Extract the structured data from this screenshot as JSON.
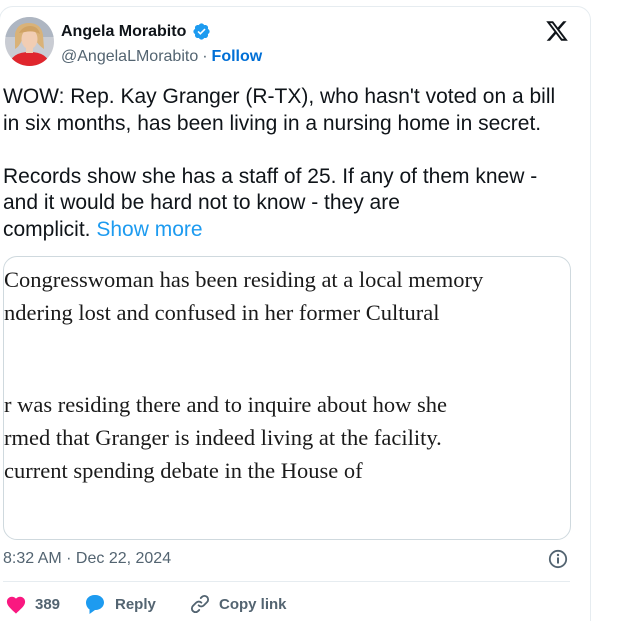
{
  "author": {
    "display_name": "Angela Morabito",
    "handle": "@AngelaLMorabito",
    "separator": "·",
    "follow_label": "Follow",
    "verified_color": "#1d9bf0",
    "avatar_icon": "profile-photo"
  },
  "brand_icon": "x-logo-icon",
  "tweet": {
    "text_paragraph_1": "WOW: Rep. Kay Granger (R-TX), who hasn't voted on a bill\nin six months, has been living in a nursing home in secret.",
    "text_paragraph_2": "Records show she has a staff of 25. If any of them knew -\nand it would be hard not to know - they are\ncomplicit. ",
    "show_more_label": "Show more"
  },
  "media": {
    "lines": [
      "Congresswoman has been residing at a local memory",
      "ndering lost and confused in her former Cultural",
      "r was residing there and to inquire about how she",
      "rmed that Granger is indeed living at the facility.",
      "current spending debate in the House of"
    ]
  },
  "meta": {
    "timestamp": "8:32 AM · Dec 22, 2024",
    "info_icon": "info-icon"
  },
  "actions": {
    "like_count": "389",
    "reply_label": "Reply",
    "copy_link_label": "Copy link",
    "like_color": "#f91880",
    "reply_color": "#1d9bf0"
  }
}
